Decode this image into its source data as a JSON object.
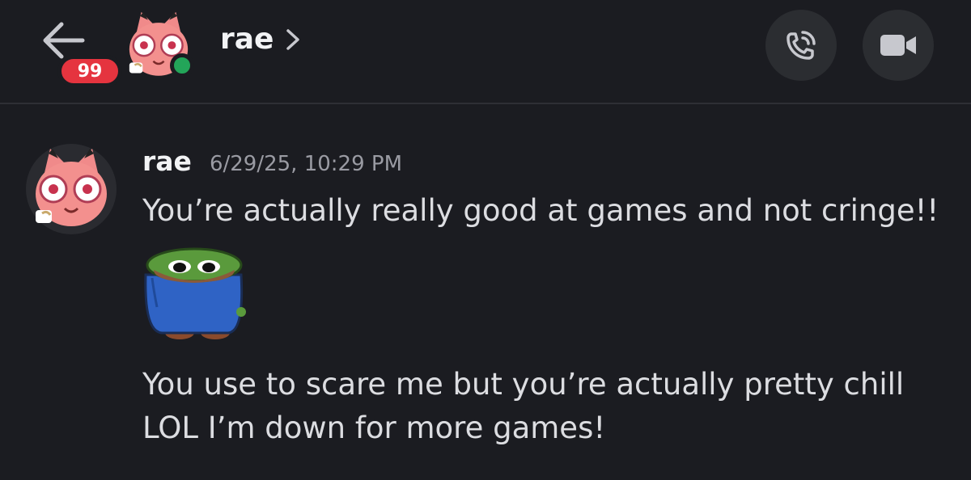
{
  "header": {
    "title": "rae",
    "unread_badge": "99",
    "status": "online",
    "status_color": "#23a559",
    "icons": [
      "back-arrow-icon",
      "chevron-right-icon",
      "phone-call-icon",
      "video-camera-icon"
    ]
  },
  "message": {
    "author": "rae",
    "timestamp": "6/29/25, 10:29 PM",
    "lines": [
      "You’re actually really good at games and not cringe!!",
      "You use to scare me but you’re actually pretty chill",
      "LOL I’m down for more games!"
    ],
    "sticker": "peepo-hoodie-sticker"
  },
  "colors": {
    "background": "#1b1c21",
    "badge": "#e5343f",
    "button_bg": "#2b2d31",
    "timestamp": "#9a9ba3"
  }
}
